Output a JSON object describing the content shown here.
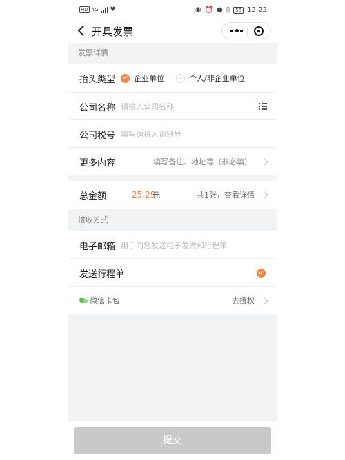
{
  "status_bar": {
    "left_badge": "HD",
    "network": "4G",
    "battery": "56",
    "time": "12:22"
  },
  "nav": {
    "title": "开具发票",
    "back_icon": "chevron-left-icon",
    "more_icon": "more-dots-icon",
    "close_icon": "target-close-icon"
  },
  "invoice_details": {
    "header": "发票详情",
    "title_type": {
      "label": "抬头类型",
      "options": [
        {
          "label": "企业单位",
          "selected": true
        },
        {
          "label": "个人/非企业单位",
          "selected": false
        }
      ]
    },
    "company_name": {
      "label": "公司名称",
      "placeholder": "请输入公司名称",
      "icon": "list-icon"
    },
    "tax_id": {
      "label": "公司税号",
      "placeholder": "填写纳税人识别号"
    },
    "more_content": {
      "label": "更多内容",
      "hint": "填写备注、地址等（非必填）"
    }
  },
  "amount": {
    "label": "总金额",
    "value": "25.29",
    "unit": "元",
    "detail": "共1张，查看详情"
  },
  "receive": {
    "header": "接收方式",
    "email": {
      "label": "电子邮箱",
      "placeholder": "用于向您发送电子发票和行程单"
    },
    "send_itinerary": {
      "label": "发送行程单",
      "checked": true
    },
    "wechat_card": {
      "label": "微信卡包",
      "action": "去授权"
    }
  },
  "submit_label": "提交",
  "colors": {
    "accent": "#f08a4b",
    "disabled_button": "#c9c9c9",
    "section_bg": "#f2f3f5"
  }
}
